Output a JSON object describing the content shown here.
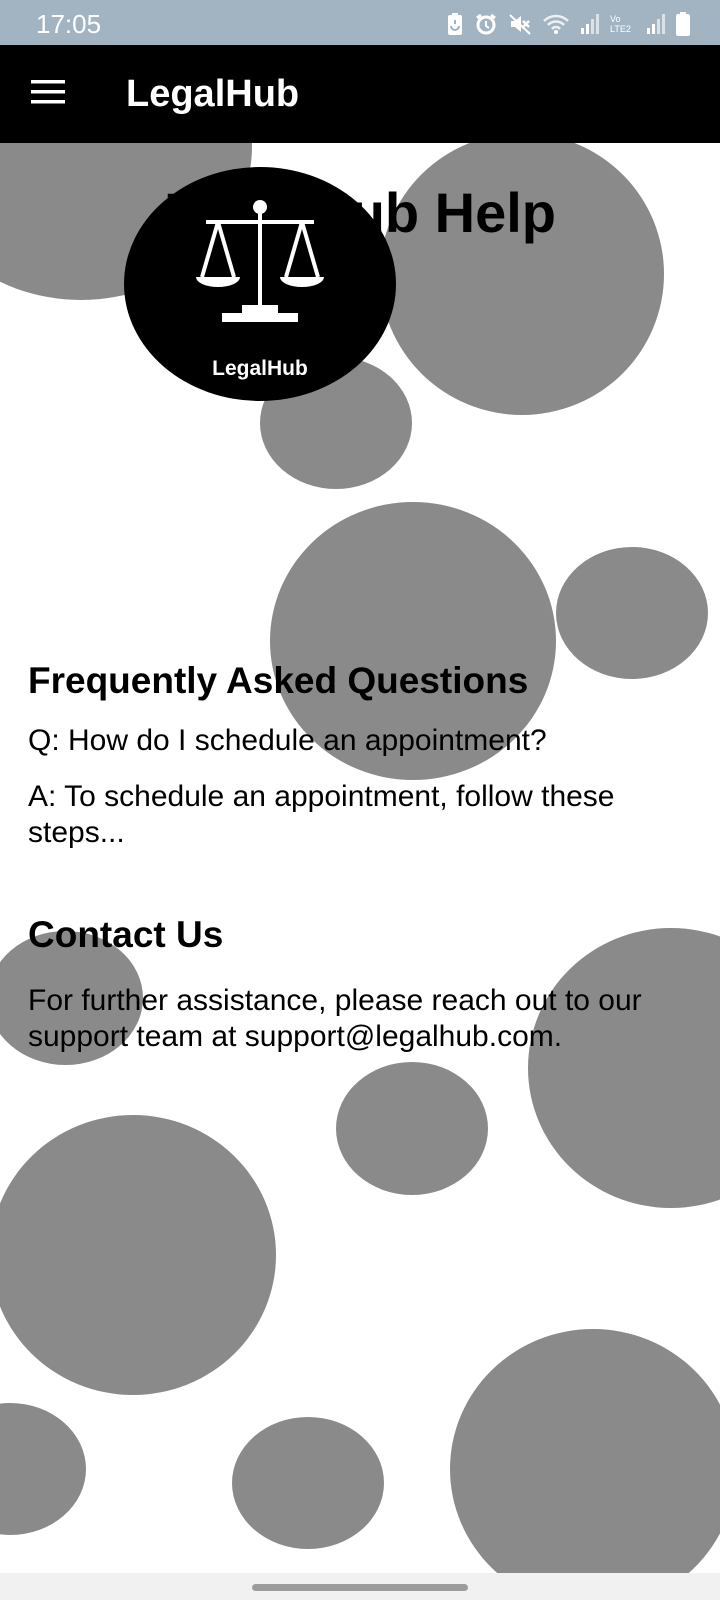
{
  "status_bar": {
    "time": "17:05",
    "icons": [
      "battery-saver-icon",
      "alarm-icon",
      "mute-icon",
      "wifi-icon",
      "signal-icon",
      "volte-icon",
      "signal-icon",
      "battery-icon"
    ],
    "volte_label": "Vo LTE2",
    "background": "#a2b4c2"
  },
  "app_bar": {
    "title": "LegalHub",
    "menu_icon": "menu-icon",
    "background": "#000000"
  },
  "page": {
    "title": "LegalHub Help",
    "logo_text": "LegalHub",
    "logo_icon": "scales-of-justice-icon",
    "faq": {
      "heading": "Frequently Asked Questions",
      "question": "Q: How do I schedule an appointment?",
      "answer": "A: To schedule an appointment, follow these steps..."
    },
    "contact": {
      "heading": "Contact Us",
      "text": "For further assistance, please reach out to our support team at support@legalhub.com."
    },
    "circle_color": "#8a8a8a"
  }
}
